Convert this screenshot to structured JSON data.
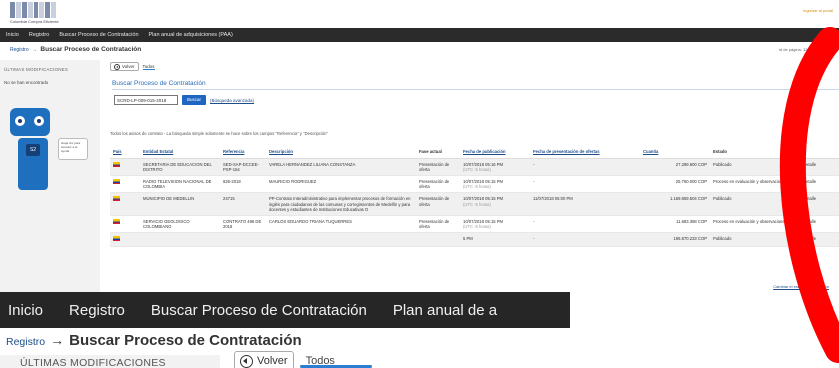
{
  "logo": {
    "caption": "Colombia Compra Eficiente"
  },
  "top_link": "Ingresar al portal",
  "nav": [
    "Inicio",
    "Registro",
    "Buscar Proceso de Contratación",
    "Plan anual de adquisiciones (PAA)"
  ],
  "breadcrumb": {
    "link": "Registro",
    "arrow": "→",
    "title": "Buscar Proceso de Contratación"
  },
  "pager": {
    "label": "Id de página:",
    "id": "12050440",
    "help": "Ayuda"
  },
  "sidebar": {
    "title": "ÚLTIMAS MODIFICACIONES",
    "empty": "No se han encontrado",
    "badge": "S2",
    "bubble": "Haga clic para acceder a la ayuda"
  },
  "toolbar": {
    "back": "Volver",
    "tab": "Todos"
  },
  "search": {
    "section_title": "Buscar Proceso de Contratación",
    "value": "SCRD-LP-009-015-2018",
    "button": "Buscar",
    "advanced": "(Búsqueda avanzada)"
  },
  "note": "Todos los avisos de contrato - La búsqueda simple solamente se hace sobre los campos \"Referencia\" y \"Descripción\"",
  "table": {
    "headers": [
      "País",
      "Entidad Estatal",
      "Referencia",
      "Descripción",
      "Fase actual",
      "Fecha de publicación",
      "Fecha de presentación de ofertas",
      "Cuantía",
      "Estado",
      ""
    ],
    "rows": [
      {
        "entity": "SECRETARIA DE EDUCACION DEL DISTRITO",
        "ref": "SED-SAP-DCCEE-PSP-154",
        "desc": "VARELA HERNANDEZ LILIANA CONSTANZA",
        "phase": "Presentación de oferta",
        "pub": "10/07/2018 05:16 PM",
        "tz": "(UTC -5 horas)",
        "offer": "-",
        "amount": "27.289.600 COP",
        "state": "Publicado",
        "action": "Detalle"
      },
      {
        "entity": "RADIO TELEVISION NACIONAL DE COLOMBIA",
        "ref": "926-2018",
        "desc": "MAURICIO RODRIGUEZ",
        "phase": "Presentación de oferta",
        "pub": "10/07/2018 05:15 PM",
        "tz": "(UTC -5 horas)",
        "offer": "-",
        "amount": "25.760.000 COP",
        "state": "Proceso en evaluación y observaciones",
        "action": "Detalle"
      },
      {
        "entity": "MUNICIPIO DE MEDELLIN",
        "ref": "24715",
        "desc": "PP-Contrato Interadministrativo para implementar procesos de formación en inglés para ciudadanos de las comunas y corregimientos de Medellín y para docentes y estudiantes de Instituciones Educativas O",
        "phase": "Presentación de oferta",
        "pub": "10/07/2018 05:15 PM",
        "tz": "(UTC -5 horas)",
        "offer": "11/07/2018 05:00 PM",
        "amount": "1.169.859.504 COP",
        "state": "Publicado",
        "action": "Detalle"
      },
      {
        "entity": "SERVICIO GEOLOGICO COLOMBIANO",
        "ref": "CONTRATO 496 DE 2018",
        "desc": "CARLOS EDUARDO TRIANA TUQUERRES",
        "phase": "Presentación de oferta",
        "pub": "10/07/2018 05:15 PM",
        "tz": "(UTC -5 horas)",
        "offer": "-",
        "amount": "11.683.388 COP",
        "state": "Proceso en evaluación y observaciones",
        "action": "Detalle"
      },
      {
        "entity": "",
        "ref": "",
        "desc": "",
        "phase": "",
        "pub": "5 PM",
        "tz": "",
        "offer": "-",
        "amount": "196.870.233 COP",
        "state": "Publicado",
        "action": "Detalle"
      }
    ]
  },
  "corner_link": "Cambiar el estilo de paginación",
  "zoom": {
    "nav": [
      "Inicio",
      "Registro",
      "Buscar Proceso de Contratación",
      "Plan anual de a"
    ],
    "crumb_link": "Registro",
    "crumb_arrow": "→",
    "crumb_title": "Buscar Proceso de Contratación",
    "side_title": "ÚLTIMAS MODIFICACIONES",
    "back": "Volver",
    "tab": "Todos"
  },
  "colors": {
    "nav_bg": "#2b2b2b",
    "link": "#1d4e89",
    "accent_blue": "#1f66c2",
    "annotation_red": "#ff0000"
  }
}
